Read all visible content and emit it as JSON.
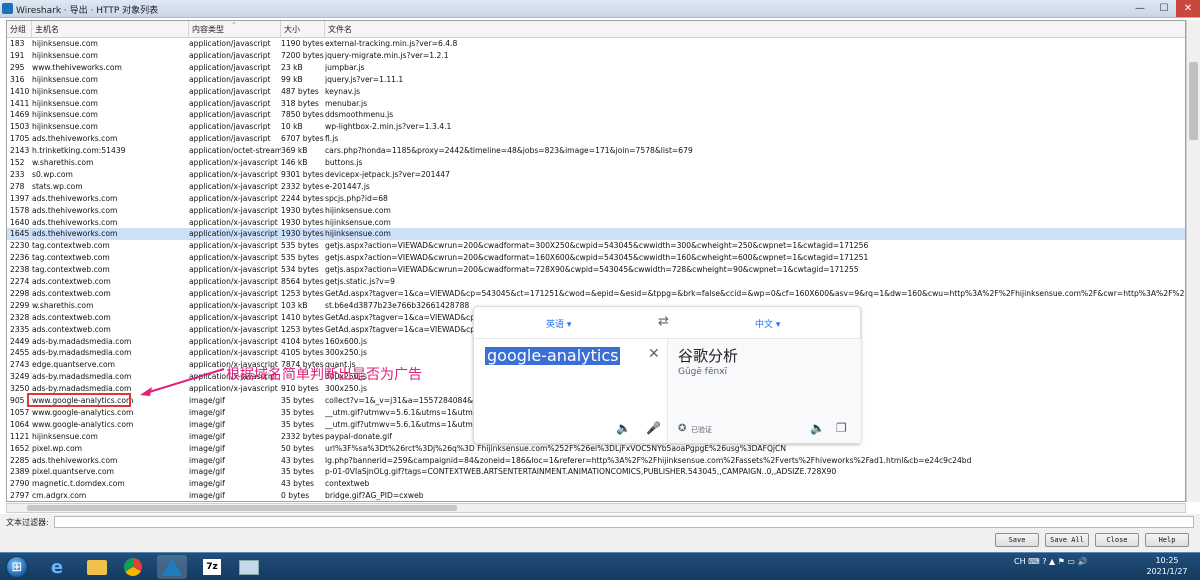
{
  "window": {
    "title": "Wireshark · 导出 · HTTP 对象列表",
    "min_glyph": "—",
    "max_glyph": "☐",
    "close_glyph": "✕"
  },
  "table": {
    "headers": [
      "分组",
      "主机名",
      "内容类型",
      "大小",
      "文件名"
    ],
    "rows": [
      [
        "183",
        "hijinksensue.com",
        "application/javascript",
        "1190 bytes",
        "external-tracking.min.js?ver=6.4.8"
      ],
      [
        "191",
        "hijinksensue.com",
        "application/javascript",
        "7200 bytes",
        "jquery-migrate.min.js?ver=1.2.1"
      ],
      [
        "295",
        "www.thehiveworks.com",
        "application/javascript",
        "23 kB",
        "jumpbar.js"
      ],
      [
        "316",
        "hijinksensue.com",
        "application/javascript",
        "99 kB",
        "jquery.js?ver=1.11.1"
      ],
      [
        "1410",
        "hijinksensue.com",
        "application/javascript",
        "487 bytes",
        "keynav.js"
      ],
      [
        "1411",
        "hijinksensue.com",
        "application/javascript",
        "318 bytes",
        "menubar.js"
      ],
      [
        "1469",
        "hijinksensue.com",
        "application/javascript",
        "7850 bytes",
        "ddsmoothmenu.js"
      ],
      [
        "1503",
        "hijinksensue.com",
        "application/javascript",
        "10 kB",
        "wp-lightbox-2.min.js?ver=1.3.4.1"
      ],
      [
        "1705",
        "ads.thehiveworks.com",
        "application/javascript",
        "6707 bytes",
        "fl.js"
      ],
      [
        "2143",
        "h.trinketking.com:51439",
        "application/octet-stream",
        "369 kB",
        "cars.php?honda=1185&proxy=2442&timeline=48&jobs=823&image=171&join=7578&list=679"
      ],
      [
        "152",
        "w.sharethis.com",
        "application/x-javascript",
        "146 kB",
        "buttons.js"
      ],
      [
        "233",
        "s0.wp.com",
        "application/x-javascript",
        "9301 bytes",
        "devicepx-jetpack.js?ver=201447"
      ],
      [
        "278",
        "stats.wp.com",
        "application/x-javascript",
        "2332 bytes",
        "e-201447.js"
      ],
      [
        "1397",
        "ads.thehiveworks.com",
        "application/x-javascript",
        "2244 bytes",
        "spcjs.php?id=68"
      ],
      [
        "1578",
        "ads.thehiveworks.com",
        "application/x-javascript",
        "1930 bytes",
        "hijinksensue.com"
      ],
      [
        "1640",
        "ads.thehiveworks.com",
        "application/x-javascript",
        "1930 bytes",
        "hijinksensue.com"
      ],
      [
        "1645",
        "ads.thehiveworks.com",
        "application/x-javascript",
        "1930 bytes",
        "hijinksensue.com"
      ],
      [
        "2230",
        "tag.contextweb.com",
        "application/x-javascript",
        "535 bytes",
        "getjs.aspx?action=VIEWAD&cwrun=200&cwadformat=300X250&cwpid=543045&cwwidth=300&cwheight=250&cwpnet=1&cwtagid=171256"
      ],
      [
        "2236",
        "tag.contextweb.com",
        "application/x-javascript",
        "535 bytes",
        "getjs.aspx?action=VIEWAD&cwrun=200&cwadformat=160X600&cwpid=543045&cwwidth=160&cwheight=600&cwpnet=1&cwtagid=171251"
      ],
      [
        "2238",
        "tag.contextweb.com",
        "application/x-javascript",
        "534 bytes",
        "getjs.aspx?action=VIEWAD&cwrun=200&cwadformat=728X90&cwpid=543045&cwwidth=728&cwheight=90&cwpnet=1&cwtagid=171255"
      ],
      [
        "2274",
        "ads.contextweb.com",
        "application/x-javascript",
        "8564 bytes",
        "getjs.static.js?v=9"
      ],
      [
        "2298",
        "ads.contextweb.com",
        "application/x-javascript",
        "1253 bytes",
        "GetAd.aspx?tagver=1&ca=VIEWAD&cp=543045&ct=171251&cwod=&epid=&esid=&tppg=&brk=false&ccid=&wp=0&cf=160X600&asv=9&rq=1&dw=160&cwu=http%3A%2F%2Fhijinksensue.com%2F&cwr=http%3A%2F%2Fwww.google"
      ],
      [
        "2299",
        "w.sharethis.com",
        "application/x-javascript",
        "103 kB",
        "st.b6e4d3877b23e766b32661428788"
      ],
      [
        "2328",
        "ads.contextweb.com",
        "application/x-javascript",
        "1410 bytes",
        "GetAd.aspx?tagver=1&ca=VIEWAD&cp                                                                                              &cwu=http%3A%2F%2Fhijinksensue.com%2F&cwr=http%3A%2F%2Fwww.google."
      ],
      [
        "2335",
        "ads.contextweb.com",
        "application/x-javascript",
        "1253 bytes",
        "GetAd.aspx?tagver=1&ca=VIEWAD&cp                                                                                              0&cwu=http%3A%2F%2Fhijinksensue.com%2F&cwr=http%3A%2F%2Fwww.google"
      ],
      [
        "2449",
        "ads-by.madadsmedia.com",
        "application/x-javascript",
        "4104 bytes",
        "160x600.js"
      ],
      [
        "2455",
        "ads-by.madadsmedia.com",
        "application/x-javascript",
        "4105 bytes",
        "300x250.js"
      ],
      [
        "2743",
        "edge.quantserve.com",
        "application/x-javascript",
        "7874 bytes",
        "quant.js"
      ],
      [
        "3249",
        "ads-by.madadsmedia.com",
        "application/x-javascript",
        "",
        "300x250.js"
      ],
      [
        "3250",
        "ads-by.madadsmedia.com",
        "application/x-javascript",
        "910 bytes",
        "300x250.js"
      ],
      [
        "905",
        "www.google-analytics.com",
        "image/gif",
        "35 bytes",
        "collect?v=1&_v=j31&a=1557284084&t                                                                                              Dt%26rct%3Dj%26q%3D%26esrc%3Ds%26frm%3D1%26source%3Dweb%26cd%"
      ],
      [
        "1057",
        "www.google-analytics.com",
        "image/gif",
        "35 bytes",
        "__utm.gif?utmwv=5.6.1&utms=1&utmn                                                                                              s&utmje=1&utmfl=12.0%20r0&utmdt=HijINKS%20ENSUE%20-%20A%20Grown%"
      ],
      [
        "1064",
        "www.google-analytics.com",
        "image/gif",
        "35 bytes",
        "__utm.gif?utmwv=5.6.1&utms=1&utmn                                                                                              -us&utmje=1&utmfl=12.0%20r0&utmdt=HijINKS%20ENSUE%20-%20A%20GrownS"
      ],
      [
        "1121",
        "hijinksensue.com",
        "image/gif",
        "2332 bytes",
        "paypal-donate.gif"
      ],
      [
        "1652",
        "pixel.wp.com",
        "image/gif",
        "50 bytes",
        "url%3F%sa%3Dt%26rct%3Dj%26q%3D                                                                                              Fhijinksensue.com%252F%26ei%3DLjFxVOC5NYb5aoaPgpgE%26usg%3DAFQjCN"
      ],
      [
        "2285",
        "ads.thehiveworks.com",
        "image/gif",
        "43 bytes",
        "lg.php?bannerid=259&campaignid=84&zoneid=186&loc=1&referer=http%3A%2F%2Fhijinksensue.com%2Fassets%2Fverts%2Fhiveworks%2Fad1.html&cb=e24c9c24bd"
      ],
      [
        "2389",
        "pixel.quantserve.com",
        "image/gif",
        "35 bytes",
        "p-01-0VIaSjnOLg.gif?tags=CONTEXTWEB.ARTSENTERTAINMENT.ANIMATIONCOMICS,PUBLISHER.543045,,CAMPAIGN..0,,ADSIZE.728X90"
      ],
      [
        "2790",
        "magnetic.t.domdex.com",
        "image/gif",
        "43 bytes",
        "contextweb"
      ],
      [
        "2797",
        "cm.adgrx.com",
        "image/gif",
        "0 bytes",
        "bridge.gif?AG_PID=cxweb"
      ]
    ]
  },
  "annotation": {
    "text": "根据域名简单判断出是否为广告",
    "color": "#e0207a"
  },
  "translator": {
    "src_lang": "英语",
    "tgt_lang": "中文",
    "src_text": "google-analytics",
    "tgt_text": "谷歌分析",
    "tgt_pinyin": "Gǔgē fēnxī",
    "verified": "已验证",
    "swap_glyph": "⇄",
    "clear_glyph": "✕",
    "speak_glyph": "🔈",
    "mic_glyph": "🎤",
    "copy_glyph": "❐",
    "verified_glyph": "✪"
  },
  "filter": {
    "label": "文本过滤器:",
    "value": ""
  },
  "buttons": {
    "save": "Save",
    "save_all": "Save All",
    "close": "Close",
    "help": "Help"
  },
  "taskbar": {
    "tray": "CH  ⌨ ?  ▲  ⚑  ▭  🔊",
    "time": "10:25",
    "date": "2021/1/27"
  }
}
